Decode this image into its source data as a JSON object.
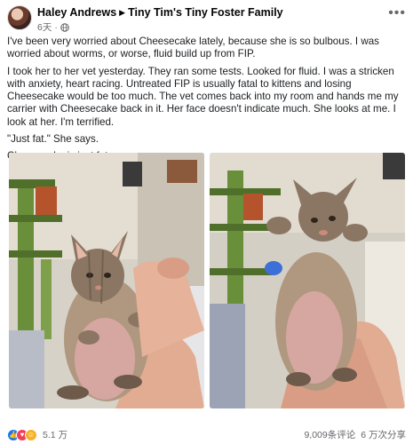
{
  "post": {
    "author": "Haley Andrews",
    "group": "Tiny Tim's Tiny Foster Family",
    "time": "6天",
    "paragraphs": [
      "I've been very worried about Cheesecake lately, because she is so bulbous. I was worried about worms, or worse, fluid build up from FIP.",
      "I took her to her vet yesterday. They ran some tests. Looked for fluid. I was a stricken with anxiety, heart racing. Untreated FIP is usually fatal to kittens and losing Cheesecake would be too much. The vet comes back into my room and hands me my carrier with Cheesecake back in it. Her face doesn't indicate much. She looks at me. I look at her. I'm terrified.",
      "\"Just fat.\" She says.",
      "Cheesecake is just fat."
    ]
  },
  "footer": {
    "reaction_count": "5.1 万",
    "comments": "9,009条评论",
    "shares": "6 万次分享"
  },
  "icons": {
    "avatar": "profile-avatar",
    "separator": "triangle-right-icon",
    "privacy": "globe-icon",
    "menu": "more-dots-icon",
    "reactions": [
      "like-icon",
      "love-icon",
      "haha-icon"
    ]
  }
}
